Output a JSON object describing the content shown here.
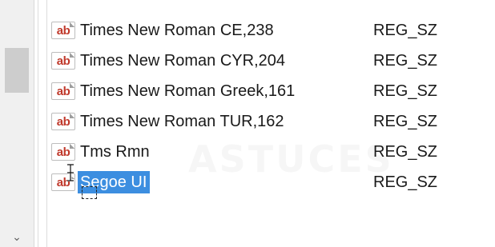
{
  "tree_pane": {
    "scroll_down_glyph": "⌄"
  },
  "values": [
    {
      "name": "Times New Roman CE,238",
      "type": "REG_SZ",
      "icon": "string-value-icon",
      "selected": false
    },
    {
      "name": "Times New Roman CYR,204",
      "type": "REG_SZ",
      "icon": "string-value-icon",
      "selected": false
    },
    {
      "name": "Times New Roman Greek,161",
      "type": "REG_SZ",
      "icon": "string-value-icon",
      "selected": false
    },
    {
      "name": "Times New Roman TUR,162",
      "type": "REG_SZ",
      "icon": "string-value-icon",
      "selected": false
    },
    {
      "name": "Tms Rmn",
      "type": "REG_SZ",
      "icon": "string-value-icon",
      "selected": false
    },
    {
      "name": "Segoe UI",
      "type": "REG_SZ",
      "icon": "string-value-icon",
      "selected": true
    }
  ],
  "icon_text": "ab",
  "watermark": "ASTUCES",
  "colors": {
    "selection": "#3c8ee0",
    "icon_text": "#c0392b"
  }
}
